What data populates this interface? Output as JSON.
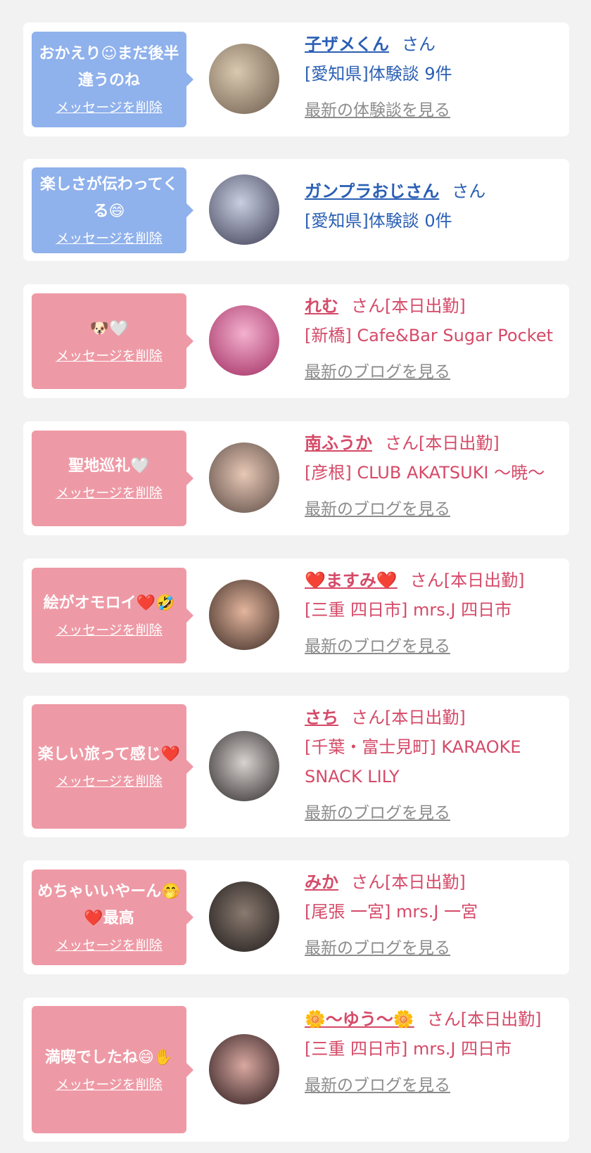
{
  "items": [
    {
      "message": "おかえり☺まだ後半違うのね",
      "delete_label": "メッセージを削除",
      "name": "子ザメくん",
      "suffix": "さん",
      "line2": "[愛知県]体験談 9件",
      "link": "最新の体験談を見る",
      "theme": "blue"
    },
    {
      "message": "楽しさが伝わってくる😄",
      "delete_label": "メッセージを削除",
      "name": "ガンプラおじさん",
      "suffix": "さん",
      "line2": "[愛知県]体験談 0件",
      "link": null,
      "theme": "blue"
    },
    {
      "message": "🐶🤍",
      "delete_label": "メッセージを削除",
      "name": "れむ",
      "suffix": "さん[本日出勤]",
      "line2": "[新橋] Cafe&Bar Sugar Pocket",
      "link": "最新のブログを見る",
      "theme": "pink"
    },
    {
      "message": "聖地巡礼🤍",
      "delete_label": "メッセージを削除",
      "name": "南ふうか",
      "suffix": "さん[本日出勤]",
      "line2": "[彦根] CLUB AKATSUKI 〜暁〜",
      "link": "最新のブログを見る",
      "theme": "pink"
    },
    {
      "message": "絵がオモロイ❤️🤣",
      "delete_label": "メッセージを削除",
      "name": "❤️ますみ❤️",
      "suffix": "さん[本日出勤]",
      "line2": "[三重 四日市] mrs.J 四日市",
      "link": "最新のブログを見る",
      "theme": "pink"
    },
    {
      "message": "楽しい旅って感じ❤️",
      "delete_label": "メッセージを削除",
      "name": "さち",
      "suffix": "さん[本日出勤]",
      "line2": "[千葉・富士見町] KARAOKE SNACK LILY",
      "link": "最新のブログを見る",
      "theme": "pink"
    },
    {
      "message": "めちゃいいやーん🤭❤️最高",
      "delete_label": "メッセージを削除",
      "name": "みか",
      "suffix": "さん[本日出勤]",
      "line2": "[尾張 一宮] mrs.J 一宮",
      "link": "最新のブログを見る",
      "theme": "pink"
    },
    {
      "message": "満喫でしたね😄✋",
      "delete_label": "メッセージを削除",
      "name": "🌼〜ゆう〜🌼",
      "suffix": "さん[本日出勤]",
      "line2": "[三重 四日市] mrs.J 四日市",
      "link": "最新のブログを見る",
      "theme": "pink"
    }
  ]
}
